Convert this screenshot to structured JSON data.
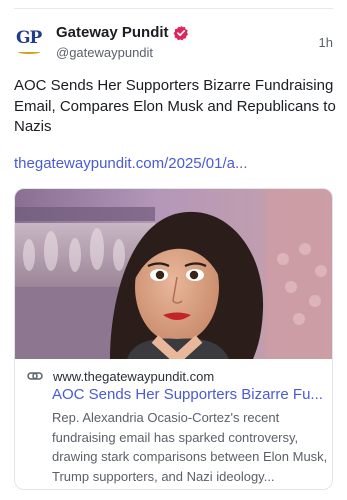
{
  "post": {
    "author_name": "Gateway Pundit",
    "author_handle": "@gatewaypundit",
    "avatar_text": "GP",
    "timestamp": "1h",
    "verified": true,
    "text": "AOC Sends Her Supporters Bizarre Fundraising Email, Compares Elon Musk and Republicans to Nazis",
    "link_text": "thegatewaypundit.com/2025/01/a..."
  },
  "card": {
    "domain": "www.thegatewaypundit.com",
    "title": "AOC Sends Her Supporters Bizarre Fu...",
    "description": "Rep. Alexandria Ocasio-Cortez's recent fundraising email has sparked controversy, drawing stark comparisons between Elon Musk, Trump supporters, and Nazi ideology..."
  },
  "colors": {
    "link": "#4a5bd6",
    "verified_badge": "#e0245e",
    "avatar_brand": "#1f3d8c",
    "text_secondary": "#5b6169"
  },
  "icons": {
    "verified": "verified-badge-icon",
    "link": "link-chain-icon"
  }
}
